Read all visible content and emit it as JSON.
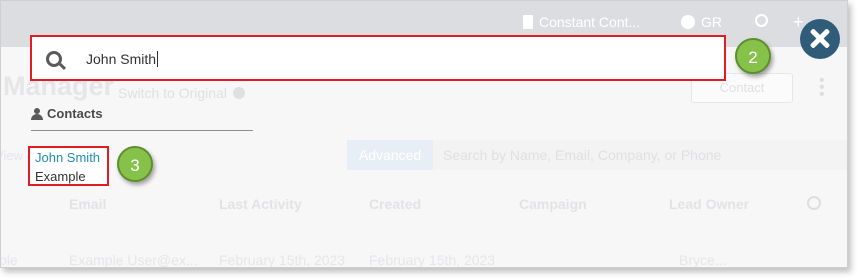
{
  "topbar": {
    "account_label": "Constant Cont...",
    "user_initials": "GR",
    "plus_label": "+"
  },
  "background": {
    "page_title": "Manager",
    "switch_link": "Switch to Original",
    "contact_button": "Contact",
    "view_label": "View",
    "advanced_button": "Advanced",
    "search_placeholder": "Search by Name, Email, Company, or Phone",
    "table_headers": [
      "Email",
      "Last Activity",
      "Created",
      "Campaign",
      "Lead Owner"
    ],
    "row": {
      "first": "ple",
      "email": "Example User@ex...",
      "last_activity": "February 15th, 2023",
      "created": "February 15th, 2023",
      "owner": "Bryce..."
    }
  },
  "search": {
    "value": "John Smith"
  },
  "results": {
    "section_label": "Contacts",
    "items": [
      {
        "name": "John Smith",
        "sub": "Example"
      }
    ]
  },
  "callouts": {
    "search": "2",
    "result": "3"
  },
  "colors": {
    "highlight": "#e31b23",
    "callout": "#86c24a",
    "link": "#1f8fb4",
    "close_button": "#2f5d79"
  }
}
